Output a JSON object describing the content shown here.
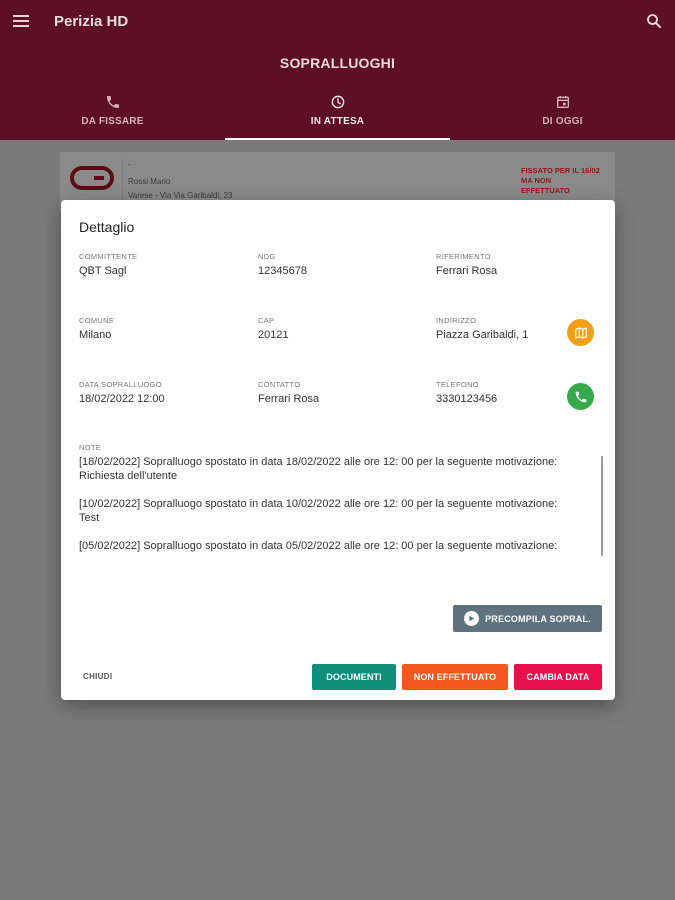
{
  "app": {
    "title": "Perizia HD",
    "page_title": "SOPRALLUOGHI"
  },
  "tabs": [
    {
      "label": "DA FISSARE",
      "icon": "phone-icon"
    },
    {
      "label": "IN ATTESA",
      "icon": "clock-icon"
    },
    {
      "label": "DI OGGI",
      "icon": "calendar-icon"
    }
  ],
  "card": {
    "line1": "-",
    "line2": "Rossi Mario",
    "line3": "Varese - Via Via Garibaldi, 23",
    "status": "FISSATO PER IL 16/02 MA NON EFFETTUATO"
  },
  "dialog": {
    "title": "Dettaglio",
    "fields": {
      "committente": {
        "label": "COMMITTENTE",
        "value": "QBT Sagl"
      },
      "ndg": {
        "label": "NDG",
        "value": "12345678"
      },
      "riferimento": {
        "label": "RIFERIMENTO",
        "value": "Ferrari Rosa"
      },
      "comune": {
        "label": "COMUNE",
        "value": "Milano"
      },
      "cap": {
        "label": "CAP",
        "value": "20121"
      },
      "indirizzo": {
        "label": "INDIRIZZO",
        "value": "Piazza Garibaldi, 1"
      },
      "data": {
        "label": "DATA SOPRALLUOGO",
        "value": "18/02/2022 12:00"
      },
      "contatto": {
        "label": "CONTATTO",
        "value": "Ferrari Rosa"
      },
      "telefono": {
        "label": "TELEFONO",
        "value": "3330123456"
      }
    },
    "notes_label": "NOTE",
    "notes": [
      "[18/02/2022] Sopralluogo spostato in data 18/02/2022 alle ore 12: 00 per la seguente motivazione: Richiesta dell'utente",
      "[10/02/2022] Sopralluogo spostato in data 10/02/2022 alle ore 12: 00 per la seguente motivazione: Test",
      "[05/02/2022] Sopralluogo spostato in data 05/02/2022 alle ore 12: 00 per la seguente motivazione:"
    ],
    "precompila_label": "PRECOMPILA SOPRAL.",
    "chiudi_label": "CHIUDI",
    "documenti_label": "DOCUMENTI",
    "non_effettuato_label": "NON EFFETTUATO",
    "cambia_data_label": "CAMBIA DATA"
  },
  "colors": {
    "appbar": "#5c0f26",
    "documenti": "#0e8f7c",
    "non_effettuato": "#f4581f",
    "cambia_data": "#e8104a",
    "precompila": "#5e7380",
    "map_button": "#f59e16",
    "phone_button": "#37a94a"
  }
}
